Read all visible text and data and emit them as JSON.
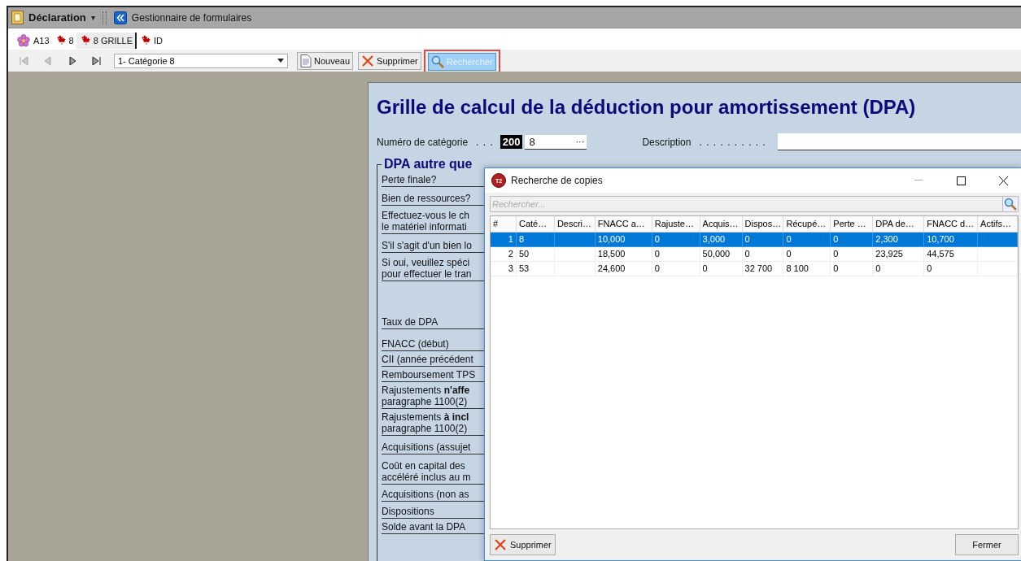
{
  "menubar": {
    "title": "Déclaration",
    "caret": "▾",
    "link": "Gestionnaire de formulaires"
  },
  "tabs": [
    {
      "label": "A13",
      "kind": "flower",
      "selected": false
    },
    {
      "label": "8",
      "kind": "maple",
      "selected": false
    },
    {
      "label": "8 GRILLE",
      "kind": "maple",
      "selected": true
    },
    {
      "label": "ID",
      "kind": "maple",
      "selected": false
    }
  ],
  "toolbar": {
    "nav": [
      {
        "kind": "first",
        "disabled": true
      },
      {
        "kind": "prev",
        "disabled": true
      },
      {
        "kind": "next",
        "disabled": false
      },
      {
        "kind": "last",
        "disabled": false
      }
    ],
    "dropdown": {
      "value": "1- Catégorie 8"
    },
    "buttons": [
      {
        "label": "Nouveau",
        "kind": "new",
        "pressed": false,
        "highlighted": false
      },
      {
        "label": "Supprimer",
        "kind": "delete",
        "pressed": false,
        "highlighted": false
      },
      {
        "label": "Rechercher",
        "kind": "search",
        "pressed": true,
        "highlighted": true
      }
    ]
  },
  "form": {
    "title": "Grille de calcul de la déduction pour amortissement (DPA)",
    "category_label": "Numéro de catégorie",
    "category_dots": ". . .",
    "category_code": "200",
    "category_value": "8",
    "category_button": "···",
    "description_label": "Description",
    "description_dots": ". . . . . . . . . .",
    "section_title": "DPA autre que",
    "items": [
      {
        "lines": [
          "Perte finale?"
        ]
      },
      {
        "lines": [
          "Bien de ressources?"
        ]
      },
      {
        "lines": [
          "Effectuez-vous le ch",
          "le matériel informati"
        ]
      },
      {
        "lines": [
          "S'il s'agit d'un bien lo"
        ]
      },
      {
        "lines": [
          "Si oui, veuillez spéci",
          "pour effectuer le tran"
        ]
      },
      {
        "lines": [
          "Taux de DPA"
        ]
      },
      {
        "lines": [
          "FNACC (début)"
        ]
      },
      {
        "lines": [
          "CII (année précédent"
        ]
      },
      {
        "lines": [
          "Remboursement TPS"
        ]
      },
      {
        "lines": [
          "Rajustements **n'affe**",
          "paragraphe 1100(2)"
        ]
      },
      {
        "lines": [
          "Rajustements **à incl**",
          "paragraphe 1100(2)"
        ]
      },
      {
        "lines": [
          "Acquisitions (assujet"
        ]
      },
      {
        "lines": [
          "Coût en capital des",
          "accéléré inclus au m"
        ]
      },
      {
        "lines": [
          "Acquisitions (non as"
        ]
      },
      {
        "lines": [
          "Dispositions"
        ]
      },
      {
        "lines": [
          "Solde avant la DPA"
        ]
      }
    ]
  },
  "dialog": {
    "title": "Recherche de copies",
    "logo": "T2",
    "search": {
      "placeholder": "Rechercher..."
    },
    "table": {
      "columns": [
        "#",
        "Caté…",
        "Descri…",
        "FNACC a…",
        "Rajuste…",
        "Acquis…",
        "Dispos…",
        "Récupé…",
        "Perte …",
        "DPA de…",
        "FNACC d…",
        "Actifs…"
      ],
      "rows": [
        {
          "selected": true,
          "cells": [
            "1",
            "8",
            "",
            "10,000",
            "0",
            "3,000",
            "0",
            "0",
            "0",
            "2,300",
            "10,700",
            ""
          ]
        },
        {
          "selected": false,
          "cells": [
            "2",
            "50",
            "",
            "18,500",
            "0",
            "50,000",
            "0",
            "0",
            "0",
            "23,925",
            "44,575",
            ""
          ]
        },
        {
          "selected": false,
          "cells": [
            "3",
            "53",
            "",
            "24,600",
            "0",
            "0",
            "32 700",
            "8 100",
            "0",
            "0",
            "0",
            ""
          ]
        }
      ]
    },
    "buttons": [
      {
        "label": "Supprimer",
        "kind": "delete"
      },
      {
        "label": "Fermer",
        "kind": "close"
      }
    ]
  }
}
